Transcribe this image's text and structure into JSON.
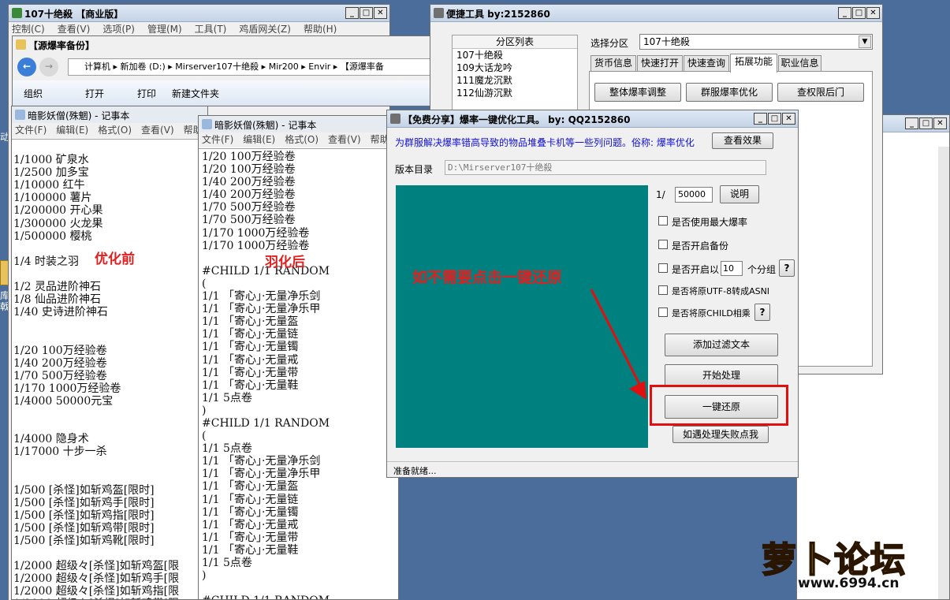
{
  "colors": {
    "desktop": "#4a6d9c",
    "teal": "#018080",
    "red_text": "#e02020",
    "blue_text": "#1010d0",
    "highlight": "#e01010"
  },
  "explorer": {
    "title": "107十绝殺 【商业版】",
    "menu": [
      "控制(C)",
      "查看(V)",
      "选项(P)",
      "管理(M)",
      "工具(T)",
      "鸡盾网关(Z)",
      "帮助(H)"
    ]
  },
  "folder": {
    "title": "【源爆率备份】",
    "path": [
      "计算机",
      "新加卷 (D:)",
      "Mirserver107十绝殺",
      "Mir200",
      "Envir",
      "【源爆率备"
    ],
    "toolbar": [
      "组织",
      "打开",
      "打印",
      "新建文件夹"
    ]
  },
  "left_notepad": {
    "title": "暗影妖僧(殊魍) - 记事本",
    "menu": [
      "文件(F)",
      "编辑(E)",
      "格式(O)",
      "查看(V)",
      "帮助(H)"
    ],
    "lines": [
      "",
      "1/1000 矿泉水",
      "1/2500 加多宝",
      "1/10000 红牛",
      "1/100000 薯片",
      "1/200000 开心果",
      "1/300000 火龙果",
      "1/500000 樱桃",
      "",
      "1/4 时装之羽",
      "",
      "1/2 灵品进阶神石",
      "1/8 仙品进阶神石",
      "1/40 史诗进阶神石",
      "",
      "",
      "1/20 100万经验卷",
      "1/40 200万经验卷",
      "1/70 500万经验卷",
      "1/170 1000万经验卷",
      "1/4000 50000元宝",
      "",
      "",
      "1/4000 隐身术",
      "1/17000 十步一杀",
      "",
      "",
      "1/500 [杀怪]如斩鸡盔[限时]",
      "1/500 [杀怪]如斩鸡手[限时]",
      "1/500 [杀怪]如斩鸡指[限时]",
      "1/500 [杀怪]如斩鸡带[限时]",
      "1/500 [杀怪]如斩鸡靴[限时]",
      "",
      "1/2000 超级々[杀怪]如斩鸡盔[限",
      "1/2000 超级々[杀怪]如斩鸡手[限",
      "1/2000 超级々[杀怪]如斩鸡指[限",
      "1/2000 超级々[杀怪]如斩鸡带[限"
    ],
    "annotation": "优化前"
  },
  "right_notepad": {
    "title": "暗影妖僧(殊魍) - 记事本",
    "menu": [
      "文件(F)",
      "编辑(E)",
      "格式(O)",
      "查看(V)",
      "帮助(H)"
    ],
    "lines": [
      "1/20 100万经验卷",
      "1/20 100万经验卷",
      "1/40 200万经验卷",
      "1/40 200万经验卷",
      "1/70 500万经验卷",
      "1/70 500万经验卷",
      "1/170 1000万经验卷",
      "1/170 1000万经验卷",
      "",
      "#CHILD 1/1 RANDOM",
      "(",
      "1/1 「寄心」·无量净乐剑",
      "1/1 「寄心」·无量净乐甲",
      "1/1 「寄心」·无量盔",
      "1/1 「寄心」·无量链",
      "1/1 「寄心」·无量镯",
      "1/1 「寄心」·无量戒",
      "1/1 「寄心」·无量带",
      "1/1 「寄心」·无量鞋",
      "1/1 5点卷",
      ")",
      "#CHILD 1/1 RANDOM",
      "(",
      "1/1 5点卷",
      "1/1 「寄心」·无量净乐剑",
      "1/1 「寄心」·无量净乐甲",
      "1/1 「寄心」·无量盔",
      "1/1 「寄心」·无量链",
      "1/1 「寄心」·无量镯",
      "1/1 「寄心」·无量戒",
      "1/1 「寄心」·无量带",
      "1/1 「寄心」·无量鞋",
      "1/1 5点卷",
      ")",
      "",
      "#CHILD 1/1 RANDOM",
      "("
    ],
    "annotation": "羽化后"
  },
  "quick_tool": {
    "title": "便捷工具  by:2152860",
    "partition_header": "分区列表",
    "partitions": [
      "107十绝殺",
      "109大话龙吟",
      "111魔龙沉默",
      "112仙游沉默"
    ],
    "select_label": "选择分区",
    "select_value": "107十绝殺",
    "tabs": [
      "货币信息",
      "快速打开",
      "快速查询",
      "拓展功能",
      "职业信息"
    ],
    "buttons": [
      "整体爆率调整",
      "群服爆率优化",
      "查权限后门"
    ]
  },
  "optimizer": {
    "title": "【免费分享】爆率一键优化工具。  by: QQ2152860",
    "info": "为群服解决爆率错高导致的物品堆叠卡机等一些列问题。俗称: 爆率优化",
    "view_effect": "查看效果",
    "dir_label": "版本目录",
    "dir_value": "D:\\Mirserver107十绝殺",
    "ratio_prefix": "1/",
    "ratio_value": "50000",
    "explain": "说明",
    "check1": "是否使用最大爆率",
    "check2": "是否开启备份",
    "check3_a": "是否开启以",
    "group_value": "10",
    "check3_b": "个分组",
    "help": "?",
    "check4": "是否将原UTF-8转成ASNI",
    "check5": "是否将原CHILD相乘",
    "add_filter": "添加过滤文本",
    "start": "开始处理",
    "restore": "一键还原",
    "fail": "如遇处理失败点我",
    "overlay": "如不需要点击一键还原",
    "status": "准备就绪..."
  },
  "logo": {
    "text": "萝卜论坛",
    "url": "www.6994.cn"
  },
  "desk_fragments": [
    "动",
    "库",
    "戟"
  ]
}
